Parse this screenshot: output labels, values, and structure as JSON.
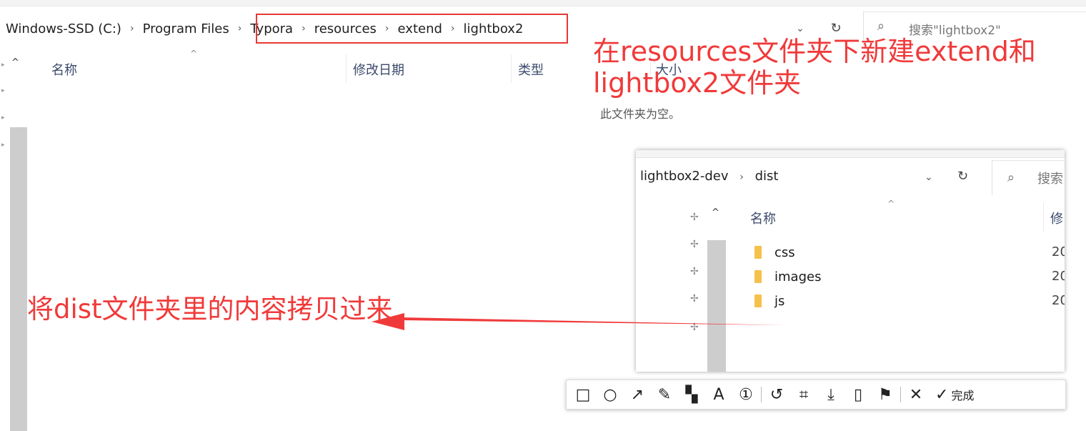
{
  "main_window": {
    "breadcrumb": [
      "Windows-SSD (C:)",
      "Program Files",
      "Typora",
      "resources",
      "extend",
      "lightbox2"
    ],
    "search_placeholder": "搜索\"lightbox2\"",
    "columns": [
      "名称",
      "修改日期",
      "类型",
      "大小"
    ],
    "empty_message": "此文件夹为空。"
  },
  "annotations": {
    "top_note": "在resources文件夹下新建extend和lightbox2文件夹",
    "left_note": "将dist文件夹里的内容拷贝过来",
    "color": "#f03a3a"
  },
  "overlay_window": {
    "breadcrumb": [
      "lightbox2-dev",
      "dist"
    ],
    "search_placeholder": "搜索",
    "columns": [
      "名称",
      "修"
    ],
    "rows": [
      {
        "name": "css",
        "date": "20"
      },
      {
        "name": "images",
        "date": "20"
      },
      {
        "name": "js",
        "date": "20"
      }
    ]
  },
  "screenshot_toolbar": {
    "tools": [
      "rectangle-tool",
      "ellipse-tool",
      "arrow-tool",
      "pen-tool",
      "mosaic-tool",
      "text-tool",
      "number-tool",
      "undo",
      "ocr-tool",
      "download",
      "save",
      "bookmark",
      "close"
    ],
    "done_label": "完成"
  },
  "colors": {
    "highlight_box": "#e53935",
    "folder": "#f5c04c",
    "column_header": "#3c4a6b"
  }
}
